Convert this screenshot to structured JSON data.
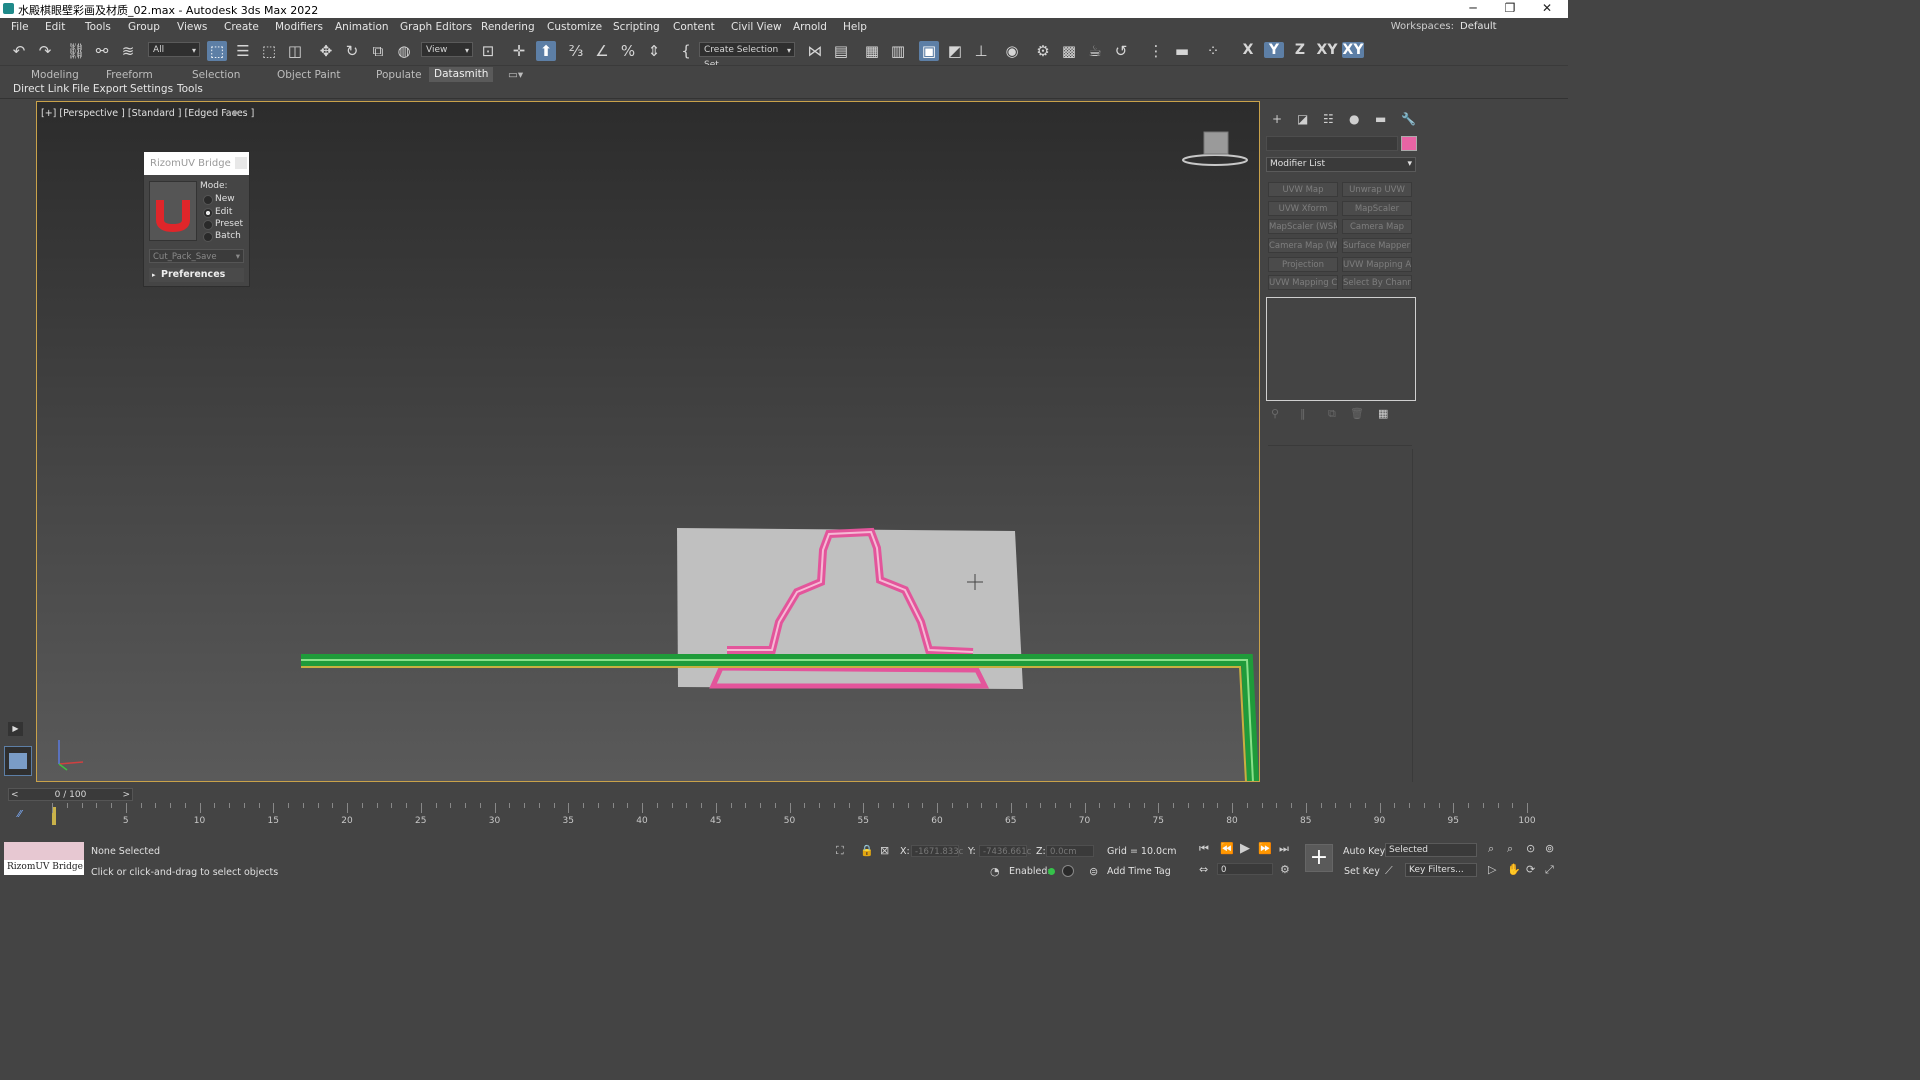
{
  "titlebar": {
    "title": "水殿棋眼壁彩画及材质_02.max - Autodesk 3ds Max 2022"
  },
  "menu": [
    "File",
    "Edit",
    "Tools",
    "Group",
    "Views",
    "Create",
    "Modifiers",
    "Animation",
    "Graph Editors",
    "Rendering",
    "Customize",
    "Scripting",
    "Content",
    "Civil View",
    "Arnold",
    "Help"
  ],
  "workspaces": {
    "label": "Workspaces:",
    "value": "Default"
  },
  "toolbar": {
    "selection_filter": "All",
    "ref_coord": "View",
    "named_selection": "Create Selection Set",
    "axes": [
      "X",
      "Y",
      "Z",
      "XY",
      "XY"
    ]
  },
  "ribbon_tabs": [
    "Modeling",
    "Freeform",
    "Selection",
    "Object Paint",
    "Populate",
    "Datasmith"
  ],
  "subbar": [
    "Direct Link",
    "File Export",
    "Settings",
    "Tools"
  ],
  "viewport": {
    "label": "[+] [Perspective ] [Standard ] [Edged Faces ]"
  },
  "rizom": {
    "title": "RizomUV Bridge",
    "mode_label": "Mode:",
    "modes": [
      "New",
      "Edit",
      "Preset",
      "Batch"
    ],
    "selected_mode": "Edit",
    "preset_value": "Cut_Pack_Save",
    "preferences": "Preferences"
  },
  "command_panel": {
    "modifier_list": "Modifier List",
    "modifier_color": "#e864a4",
    "modifier_buttons": [
      "UVW Map",
      "Unwrap UVW",
      "UVW Xform",
      "MapScaler",
      "MapScaler (WSM)",
      "Camera Map",
      "Camera Map (WSM)",
      "Surface Mapper (WSM)",
      "Projection",
      "UVW Mapping Add",
      "UVW Mapping Clear",
      "Select By Channel"
    ]
  },
  "timeline": {
    "frame_label": "0 / 100",
    "ticks": [
      "5",
      "10",
      "15",
      "20",
      "25",
      "30",
      "35",
      "40",
      "45",
      "50",
      "55",
      "60",
      "65",
      "70",
      "75",
      "80",
      "85",
      "90",
      "95",
      "100"
    ]
  },
  "status": {
    "script_label": "RizomUV Bridge",
    "selection": "None Selected",
    "prompt": "Click or click-and-drag to select objects",
    "x_label": "X:",
    "x_value": "-1671.833c",
    "y_label": "Y:",
    "y_value": "-7436.661c",
    "z_label": "Z:",
    "z_value": "0.0cm",
    "grid": "Grid = 10.0cm",
    "enabled": "Enabled:",
    "add_time_tag": "Add Time Tag",
    "auto_key": "Auto Key",
    "set_key": "Set Key",
    "selected": "Selected",
    "key_filters": "Key Filters...",
    "frame_value": "0"
  }
}
